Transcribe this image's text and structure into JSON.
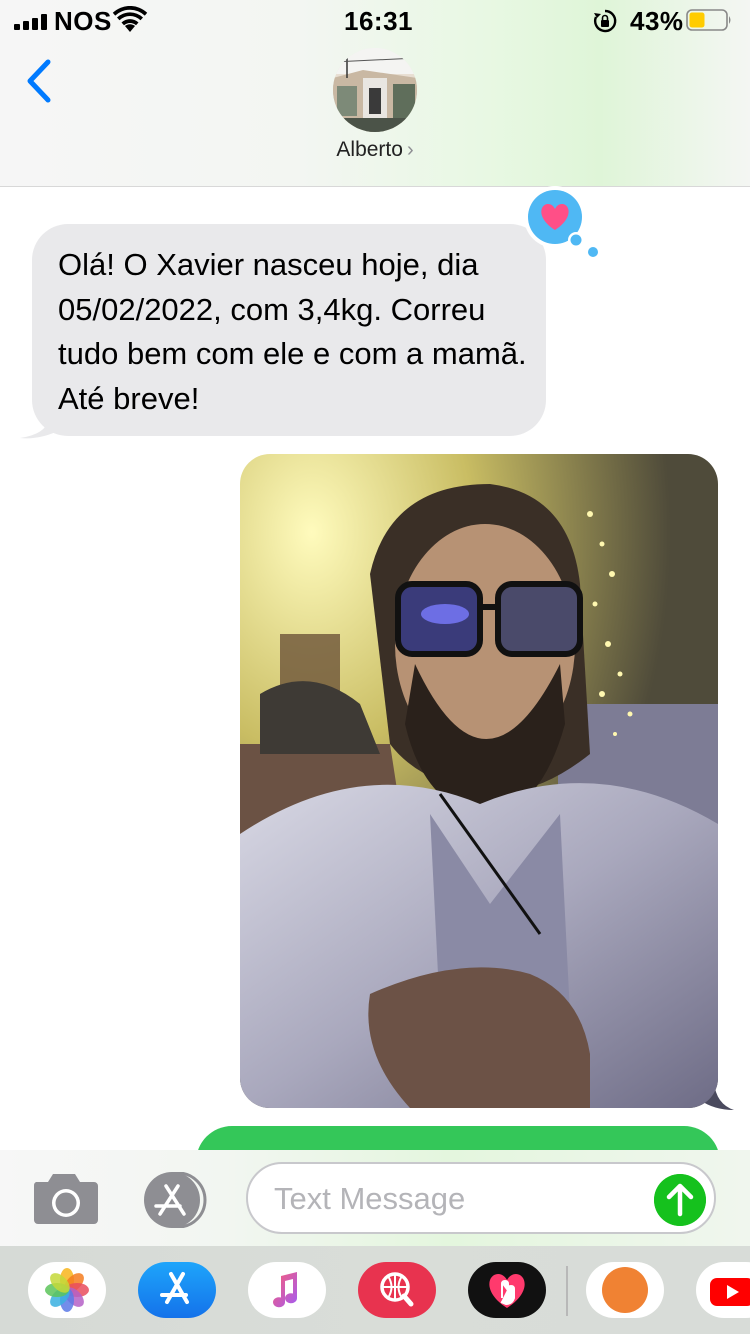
{
  "status_bar": {
    "carrier": "NOS",
    "time": "16:31",
    "battery_percent": "43%",
    "battery_level": 0.43,
    "battery_color": "#ffcc00"
  },
  "header": {
    "contact_name": "Alberto",
    "back_icon": "chevron-left-icon",
    "accent_color": "#007aff"
  },
  "conversation": {
    "incoming_message": {
      "text": "Olá! O Xavier nasceu hoje, dia 05/02/2022, com 3,4kg. Correu tudo bem com ele e com a mamã. Até breve!",
      "tapback": "heart-icon",
      "tapback_color": "#ff4f87",
      "bubble_color": "#e9e9eb"
    },
    "outgoing_photo": {
      "icon": "selfie-photo"
    },
    "outgoing_bubble_color": "#34c759"
  },
  "input_bar": {
    "placeholder": "Text Message",
    "camera_icon": "camera-icon",
    "apps_icon": "app-store-icon",
    "send_icon": "arrow-up-icon",
    "send_color": "#15c11d"
  },
  "app_drawer": {
    "apps": [
      {
        "name": "photos-app",
        "icon": "photos-icon"
      },
      {
        "name": "app-store-app",
        "icon": "app-store-icon"
      },
      {
        "name": "music-app",
        "icon": "music-note-icon"
      },
      {
        "name": "images-search-app",
        "icon": "globe-search-icon"
      },
      {
        "name": "digital-touch-app",
        "icon": "heart-touch-icon"
      },
      {
        "name": "memoji-app",
        "icon": "memoji-icon"
      },
      {
        "name": "youtube-app",
        "icon": "youtube-icon"
      }
    ]
  }
}
